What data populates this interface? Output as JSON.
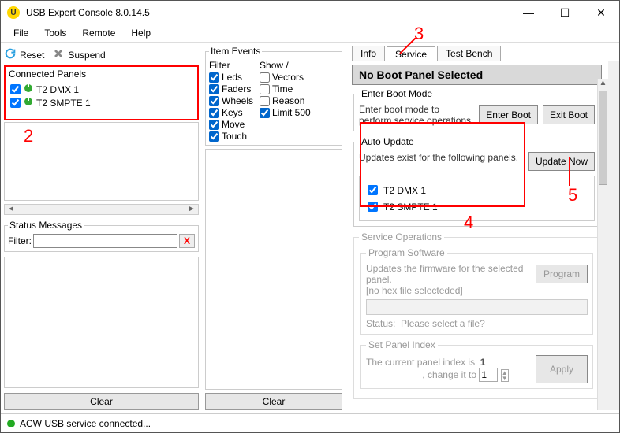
{
  "title": "USB Expert Console 8.0.14.5",
  "menubar": [
    "File",
    "Tools",
    "Remote",
    "Help"
  ],
  "toolbar": {
    "reset": "Reset",
    "suspend": "Suspend"
  },
  "connected_panels": {
    "label": "Connected Panels",
    "items": [
      {
        "name": "T2 DMX 1",
        "checked": true
      },
      {
        "name": "T2 SMPTE 1",
        "checked": true
      }
    ]
  },
  "status_messages": {
    "label": "Status Messages",
    "filter_label": "Filter:",
    "clear": "Clear"
  },
  "item_events": {
    "label": "Item Events",
    "filter_label": "Filter",
    "show_label": "Show /",
    "filter": [
      {
        "name": "Leds",
        "checked": true
      },
      {
        "name": "Faders",
        "checked": true
      },
      {
        "name": "Wheels",
        "checked": true
      },
      {
        "name": "Keys",
        "checked": true
      },
      {
        "name": "Move",
        "checked": true
      },
      {
        "name": "Touch",
        "checked": true
      }
    ],
    "show": [
      {
        "name": "Vectors",
        "checked": false
      },
      {
        "name": "Time",
        "checked": false
      },
      {
        "name": "Reason",
        "checked": false
      },
      {
        "name": "Limit 500",
        "checked": true
      }
    ],
    "clear": "Clear"
  },
  "tabs": {
    "info": "Info",
    "service": "Service",
    "test_bench": "Test Bench",
    "active": "service"
  },
  "service": {
    "header": "No Boot Panel Selected",
    "boot": {
      "label": "Enter Boot Mode",
      "text": "Enter boot mode to perform service operations.",
      "enter": "Enter Boot",
      "exit": "Exit Boot"
    },
    "auto_update": {
      "label": "Auto Update",
      "text": "Updates exist for the following panels.",
      "button": "Update Now",
      "panels": [
        {
          "name": "T2 DMX 1",
          "checked": true
        },
        {
          "name": "T2 SMPTE 1",
          "checked": true
        }
      ]
    },
    "ops": {
      "label": "Service Operations",
      "program": {
        "label": "Program Software",
        "text": "Updates the firmware for the selected panel.",
        "nohex": "[no hex file selecteded]",
        "status_label": "Status:",
        "status": "Please select a file?",
        "button": "Program"
      },
      "index": {
        "label": "Set Panel Index",
        "text1": "The current panel index is",
        "value": "1",
        "text2": ", change it to",
        "spin": "1",
        "button": "Apply"
      }
    }
  },
  "statusbar": "ACW USB service connected...",
  "callouts": {
    "c2": "2",
    "c3": "3",
    "c4": "4",
    "c5": "5"
  }
}
